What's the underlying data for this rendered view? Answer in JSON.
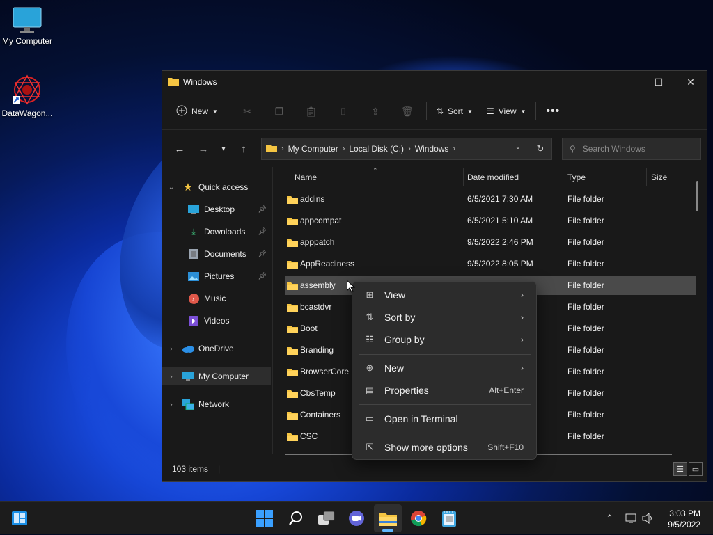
{
  "desktop": {
    "icons": [
      {
        "label": "My Computer",
        "icon": "monitor-icon"
      },
      {
        "label": "DataWagon...",
        "icon": "datawagon-app-icon"
      }
    ]
  },
  "window": {
    "title": "Windows",
    "toolbar": {
      "new_label": "New",
      "sort_label": "Sort",
      "view_label": "View"
    },
    "breadcrumb": [
      "My Computer",
      "Local Disk (C:)",
      "Windows"
    ],
    "search_placeholder": "Search Windows",
    "nav": {
      "quick_access": "Quick access",
      "items": [
        {
          "label": "Desktop",
          "pinned": true
        },
        {
          "label": "Downloads",
          "pinned": true
        },
        {
          "label": "Documents",
          "pinned": true
        },
        {
          "label": "Pictures",
          "pinned": true
        },
        {
          "label": "Music",
          "pinned": false
        },
        {
          "label": "Videos",
          "pinned": false
        }
      ],
      "onedrive": "OneDrive",
      "my_computer": "My Computer",
      "network": "Network"
    },
    "columns": {
      "name": "Name",
      "date": "Date modified",
      "type": "Type",
      "size": "Size"
    },
    "files": [
      {
        "name": "addins",
        "date": "6/5/2021 7:30 AM",
        "type": "File folder"
      },
      {
        "name": "appcompat",
        "date": "6/5/2021 5:10 AM",
        "type": "File folder"
      },
      {
        "name": "apppatch",
        "date": "9/5/2022 2:46 PM",
        "type": "File folder"
      },
      {
        "name": "AppReadiness",
        "date": "9/5/2022 8:05 PM",
        "type": "File folder"
      },
      {
        "name": "assembly",
        "date": "",
        "type": "File folder"
      },
      {
        "name": "bcastdvr",
        "date": "",
        "type": "File folder"
      },
      {
        "name": "Boot",
        "date": "",
        "type": "File folder"
      },
      {
        "name": "Branding",
        "date": "",
        "type": "File folder"
      },
      {
        "name": "BrowserCore",
        "date": "",
        "type": "File folder"
      },
      {
        "name": "CbsTemp",
        "date": "",
        "type": "File folder"
      },
      {
        "name": "Containers",
        "date": "",
        "type": "File folder"
      },
      {
        "name": "CSC",
        "date": "",
        "type": "File folder"
      }
    ],
    "status": "103 items"
  },
  "context_menu": {
    "items": [
      {
        "label": "View",
        "icon": "grid-icon",
        "submenu": true,
        "shortcut": ""
      },
      {
        "label": "Sort by",
        "icon": "sort-icon",
        "submenu": true,
        "shortcut": ""
      },
      {
        "label": "Group by",
        "icon": "group-icon",
        "submenu": true,
        "shortcut": ""
      },
      {
        "label": "New",
        "icon": "plus-circle-icon",
        "submenu": true,
        "shortcut": ""
      },
      {
        "label": "Properties",
        "icon": "properties-icon",
        "submenu": false,
        "shortcut": "Alt+Enter"
      },
      {
        "label": "Open in Terminal",
        "icon": "terminal-icon",
        "submenu": false,
        "shortcut": ""
      },
      {
        "label": "Show more options",
        "icon": "more-options-icon",
        "submenu": false,
        "shortcut": "Shift+F10"
      }
    ]
  },
  "taskbar": {
    "time": "3:03 PM",
    "date": "9/5/2022"
  },
  "colors": {
    "folder": "#f5c542",
    "accent": "#0078d4"
  }
}
